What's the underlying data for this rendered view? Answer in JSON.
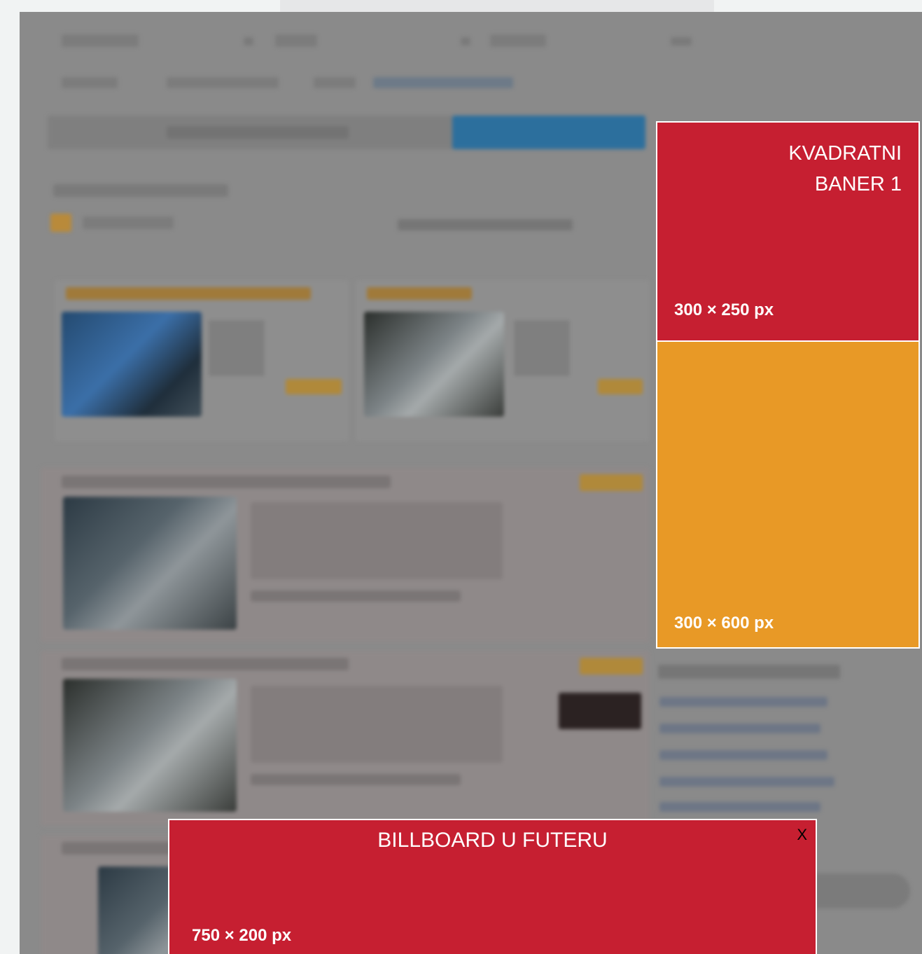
{
  "ads": {
    "square1": {
      "title_line1": "KVADRATNI",
      "title_line2": "BANER 1",
      "size": "300 × 250 px",
      "color": "#c61f31"
    },
    "halfpage": {
      "size": "300 × 600 px",
      "color": "#e89926"
    },
    "billboard": {
      "title": "BILLBOARD U FUTERU",
      "size": "750 × 200 px",
      "close_label": "X",
      "color": "#c61f31"
    }
  },
  "background": {
    "page_color": "#f1f3f3",
    "overlay_color": "#8a8a8a"
  }
}
